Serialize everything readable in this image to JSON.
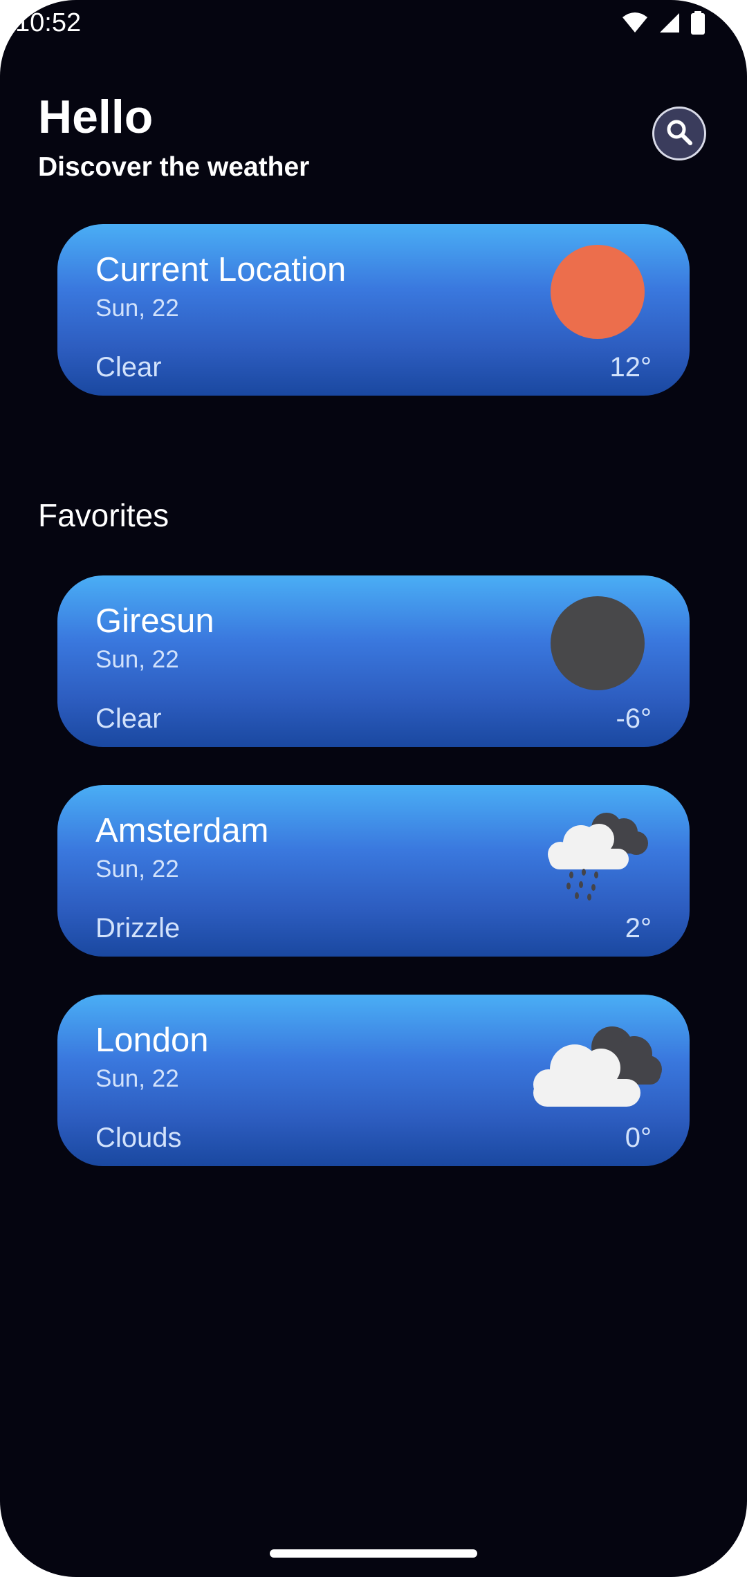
{
  "status_bar": {
    "time": "10:52"
  },
  "header": {
    "greeting": "Hello",
    "subtitle": "Discover the weather"
  },
  "current_location": {
    "city": "Current Location",
    "date": "Sun, 22",
    "condition": "Clear",
    "temperature": "12°",
    "icon": "sun-icon",
    "icon_color": "#ec6e4c"
  },
  "favorites": {
    "title": "Favorites",
    "items": [
      {
        "city": "Giresun",
        "date": "Sun, 22",
        "condition": "Clear",
        "temperature": "-6°",
        "icon": "moon-icon",
        "icon_color": "#48484a"
      },
      {
        "city": "Amsterdam",
        "date": "Sun, 22",
        "condition": "Drizzle",
        "temperature": "2°",
        "icon": "drizzle-cloud-icon"
      },
      {
        "city": "London",
        "date": "Sun, 22",
        "condition": "Clouds",
        "temperature": "0°",
        "icon": "clouds-icon"
      }
    ]
  },
  "colors": {
    "background": "#050510",
    "card_gradient_top": "#4aaef5",
    "card_gradient_bottom": "#1a48a0",
    "search_button": "#3a3c5c"
  }
}
